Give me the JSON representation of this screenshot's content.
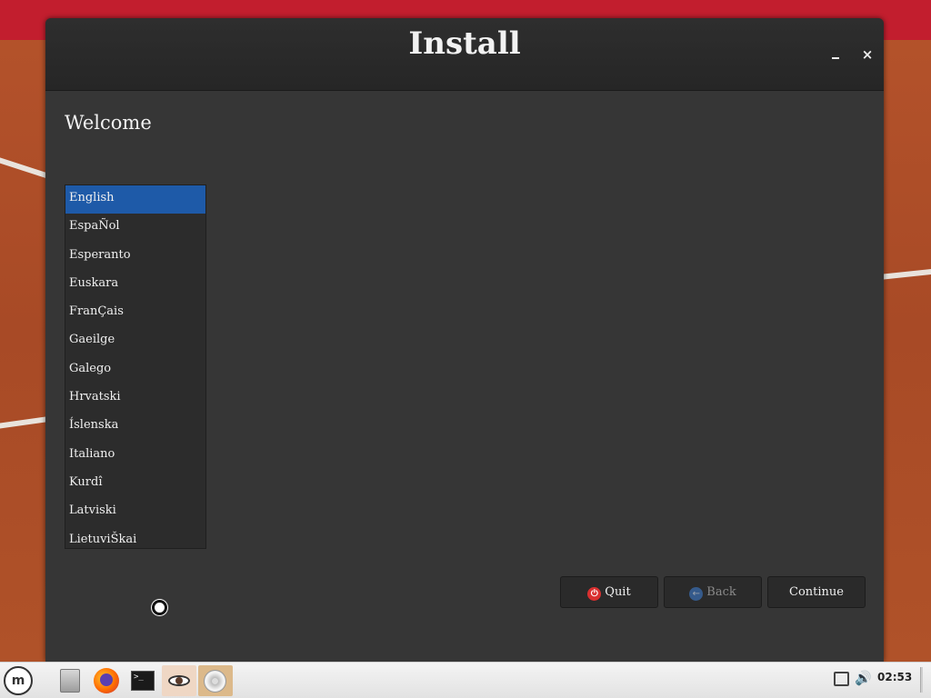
{
  "window": {
    "title": "Install",
    "minimize_icon": "minimize-icon",
    "close_label": "×"
  },
  "page": {
    "heading": "Welcome"
  },
  "languages": {
    "selected": "English",
    "items": [
      "English",
      "EspaÑol",
      "Esperanto",
      "Euskara",
      "FranÇais",
      "Gaeilge",
      "Galego",
      "Hrvatski",
      "Íslenska",
      "Italiano",
      "Kurdî",
      "Latviski",
      "LietuviŠkai"
    ]
  },
  "buttons": {
    "quit": "Quit",
    "back": "Back",
    "continue": "Continue"
  },
  "taskbar": {
    "menu_icon": "mint-menu-icon",
    "terminal_prompt": ">_",
    "clock": "02:53"
  },
  "colors": {
    "selection": "#1e5aa8",
    "window_bg": "#363636",
    "desktop_top": "#c21e2e",
    "quit_icon": "#d93030"
  }
}
